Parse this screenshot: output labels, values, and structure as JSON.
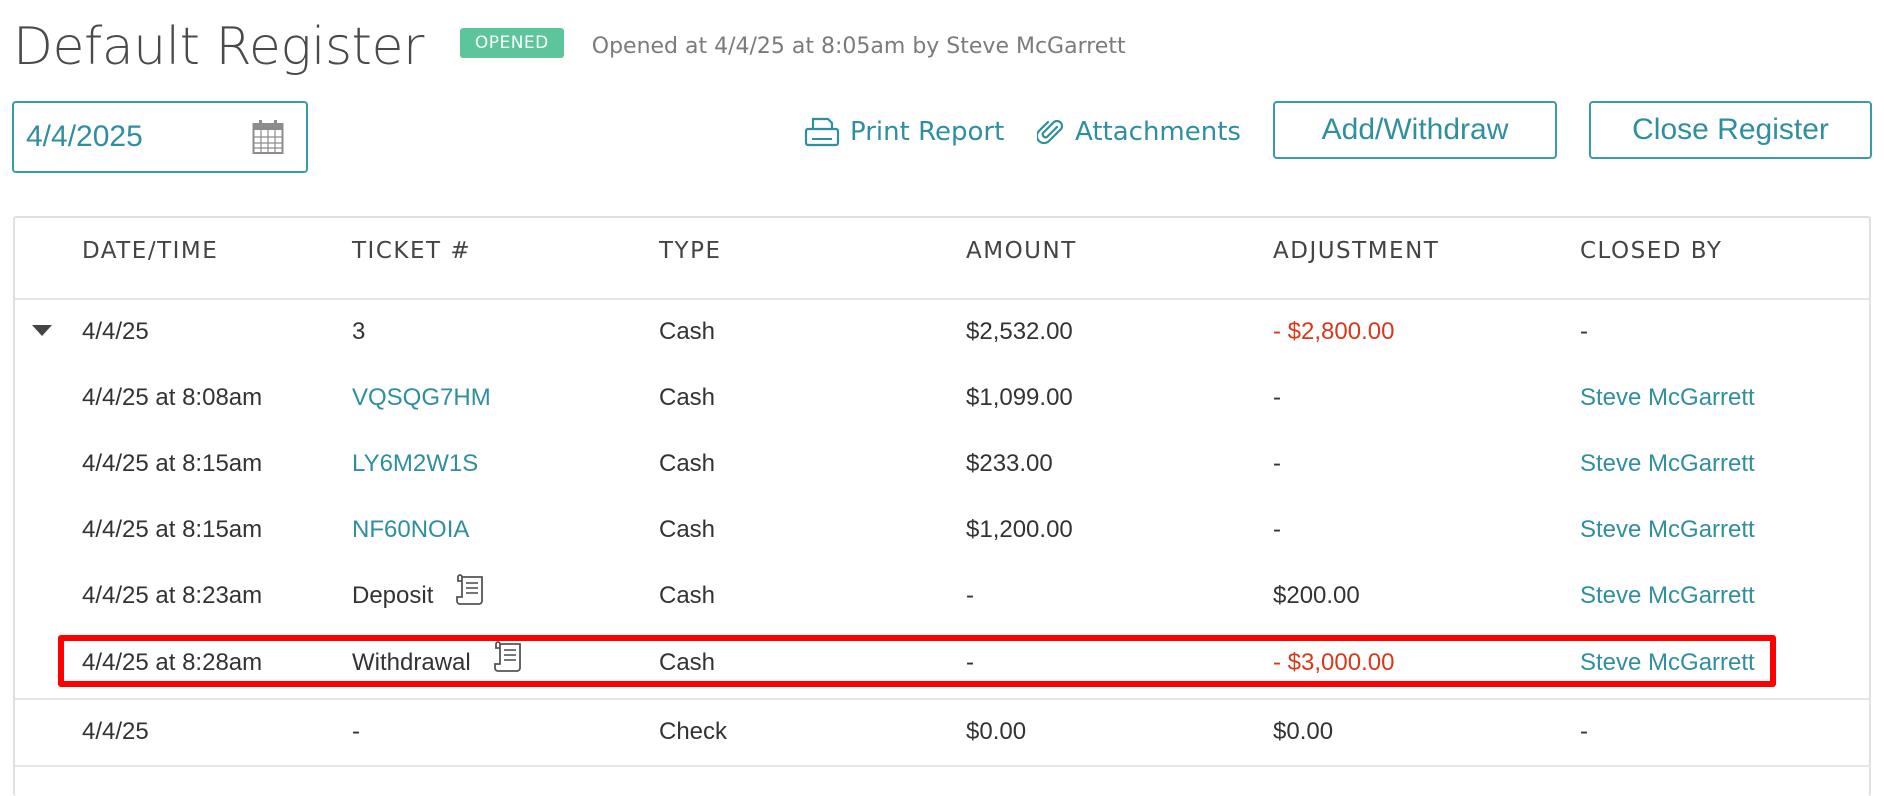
{
  "header": {
    "title": "Default Register",
    "status_badge": "OPENED",
    "opened_text": "Opened at 4/4/25 at 8:05am by Steve McGarrett"
  },
  "toolbar": {
    "date_value": "4/4/2025",
    "print_report": "Print Report",
    "attachments": "Attachments",
    "add_withdraw": "Add/Withdraw",
    "close_register": "Close Register"
  },
  "table": {
    "headers": [
      "DATE/TIME",
      "TICKET #",
      "TYPE",
      "AMOUNT",
      "ADJUSTMENT",
      "CLOSED BY"
    ],
    "groups": [
      {
        "summary": {
          "date": "4/4/25",
          "ticket": "3",
          "type": "Cash",
          "amount": "$2,532.00",
          "adjustment": "- $2,800.00",
          "closed_by": "-"
        },
        "rows": [
          {
            "date": "4/4/25 at 8:08am",
            "ticket": "VQSQG7HM",
            "type": "Cash",
            "amount": "$1,099.00",
            "adjustment": "-",
            "closed_by": "Steve McGarrett"
          },
          {
            "date": "4/4/25 at 8:15am",
            "ticket": "LY6M2W1S",
            "type": "Cash",
            "amount": "$233.00",
            "adjustment": "-",
            "closed_by": "Steve McGarrett"
          },
          {
            "date": "4/4/25 at 8:15am",
            "ticket": "NF60NOIA",
            "type": "Cash",
            "amount": "$1,200.00",
            "adjustment": "-",
            "closed_by": "Steve McGarrett"
          },
          {
            "date": "4/4/25 at 8:23am",
            "ticket": "Deposit",
            "type": "Cash",
            "amount": "-",
            "adjustment": "$200.00",
            "closed_by": "Steve McGarrett"
          },
          {
            "date": "4/4/25 at 8:28am",
            "ticket": "Withdrawal",
            "type": "Cash",
            "amount": "-",
            "adjustment": "- $3,000.00",
            "closed_by": "Steve McGarrett"
          }
        ]
      },
      {
        "summary": {
          "date": "4/4/25",
          "ticket": "-",
          "type": "Check",
          "amount": "$0.00",
          "adjustment": "$0.00",
          "closed_by": "-"
        }
      }
    ]
  },
  "colors": {
    "accent": "#2f8fa0",
    "badge_green": "#5cc69a",
    "negative": "#d9391b",
    "highlight": "#ff0000"
  },
  "icons": {
    "calendar": "calendar-icon",
    "print": "printer-icon",
    "attachments": "paperclip-icon",
    "receipt": "receipt-icon",
    "expand": "caret-down-icon"
  }
}
